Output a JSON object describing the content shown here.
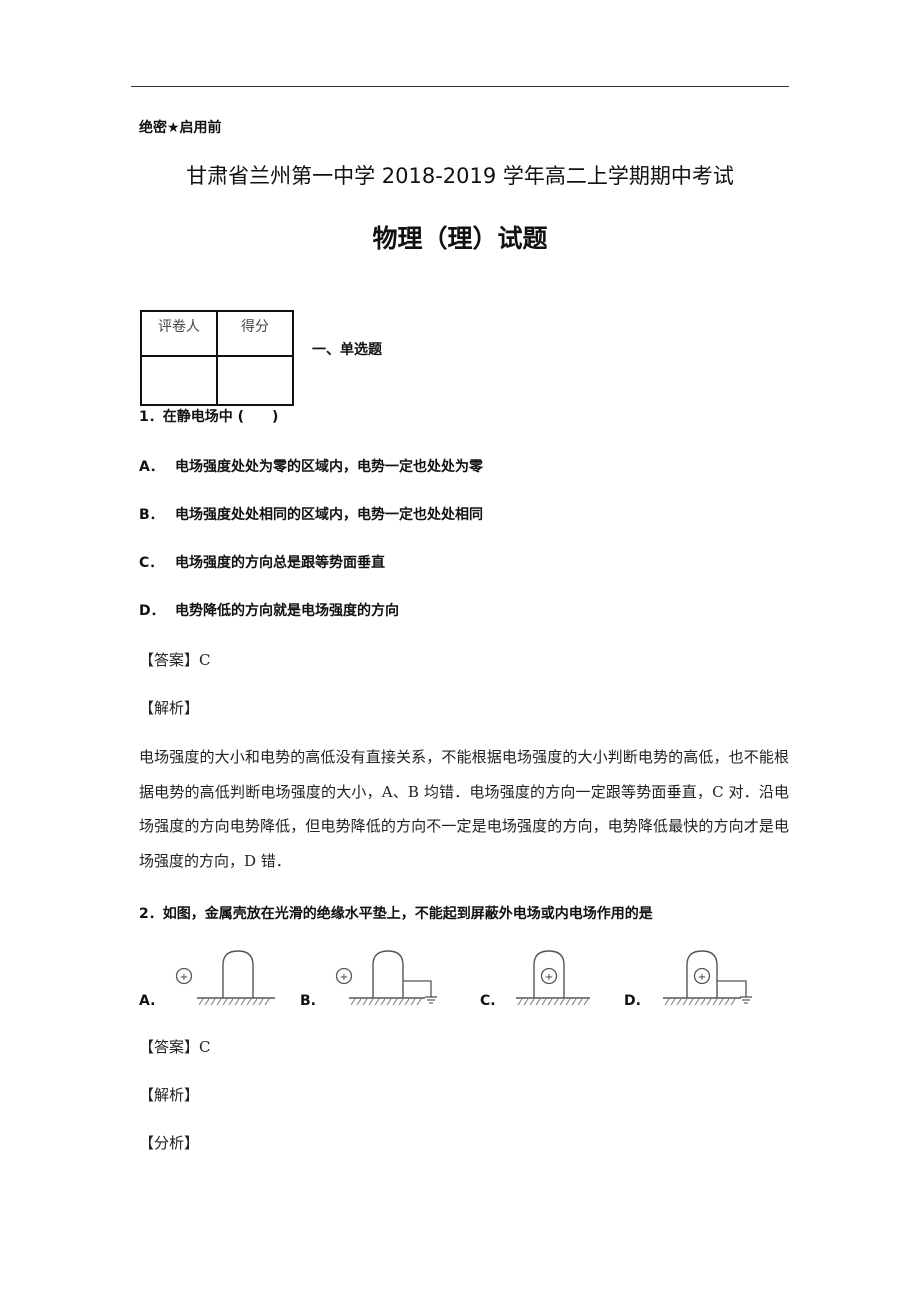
{
  "header": {
    "secret_mark": "绝密★启用前",
    "title": "甘肃省兰州第一中学 2018-2019 学年高二上学期期中考试",
    "subtitle": "物理（理）试题"
  },
  "score_table": {
    "headers": [
      "评卷人",
      "得分"
    ],
    "values": [
      "",
      ""
    ]
  },
  "section_title": "一、单选题",
  "questions": [
    {
      "stem": "1．在静电场中 (　　)",
      "options": [
        {
          "letter": "A．",
          "text": "电场强度处处为零的区域内，电势一定也处处为零"
        },
        {
          "letter": "B．",
          "text": "电场强度处处相同的区域内，电势一定也处处相同"
        },
        {
          "letter": "C．",
          "text": "电场强度的方向总是跟等势面垂直"
        },
        {
          "letter": "D．",
          "text": "电势降低的方向就是电场强度的方向"
        }
      ],
      "answer_label": "【答案】C",
      "analysis_label": "【解析】",
      "analysis_text": "电场强度的大小和电势的高低没有直接关系，不能根据电场强度的大小判断电势的高低，也不能根据电势的高低判断电场强度的大小，A、B 均错．电场强度的方向一定跟等势面垂直，C 对．沿电场强度的方向电势降低，但电势降低的方向不一定是电场强度的方向，电势降低最快的方向才是电场强度的方向，D 错．"
    },
    {
      "stem": "2．如图，金属壳放在光滑的绝缘水平垫上，不能起到屏蔽外电场或内电场作用的是",
      "figure_options": [
        {
          "letter": "A.",
          "charge_position": "outside",
          "grounded": false,
          "charge_symbol": "+"
        },
        {
          "letter": "B.",
          "charge_position": "outside",
          "grounded": true,
          "charge_symbol": "+"
        },
        {
          "letter": "C.",
          "charge_position": "inside",
          "grounded": false,
          "charge_symbol": "+"
        },
        {
          "letter": "D.",
          "charge_position": "inside",
          "grounded": true,
          "charge_symbol": "+"
        }
      ],
      "answer_label": "【答案】C",
      "analysis_label": "【解析】",
      "sub_analysis_label": "【分析】"
    }
  ]
}
